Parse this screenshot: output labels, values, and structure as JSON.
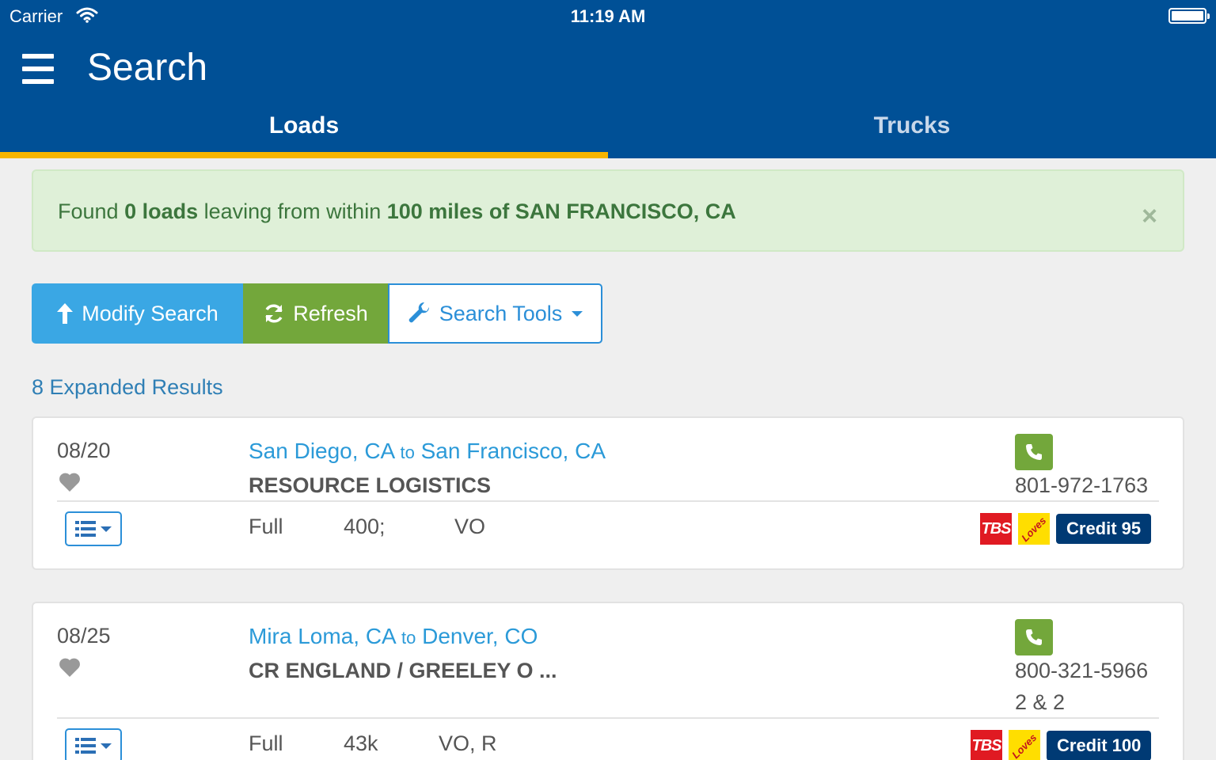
{
  "status_bar": {
    "carrier": "Carrier",
    "time": "11:19 AM"
  },
  "header": {
    "title": "Search"
  },
  "tabs": [
    {
      "label": "Loads",
      "active": true
    },
    {
      "label": "Trucks",
      "active": false
    }
  ],
  "alert": {
    "pre": "Found ",
    "count": "0 loads",
    "mid": " leaving from within ",
    "location": "100 miles of SAN FRANCISCO, CA",
    "close": "×"
  },
  "toolbar": {
    "modify_label": "Modify Search",
    "refresh_label": "Refresh",
    "tools_label": "Search Tools"
  },
  "results": {
    "count_label": "8 Expanded Results"
  },
  "loads": [
    {
      "date": "08/20",
      "origin": "San Diego, CA",
      "to": "to",
      "destination": "San Francisco, CA",
      "company": "RESOURCE LOGISTICS",
      "phone": "801-972-1763",
      "extra": "",
      "size": "Full",
      "weight": "400;",
      "equipment": "VO",
      "tbs": "TBS",
      "loves": "Loves",
      "credit": "Credit 95"
    },
    {
      "date": "08/25",
      "origin": "Mira Loma, CA",
      "to": "to",
      "destination": "Denver, CO",
      "company": "CR ENGLAND / GREELEY O ...",
      "phone": "800-321-5966",
      "extra": "2 & 2",
      "size": "Full",
      "weight": "43k",
      "equipment": "VO, R",
      "tbs": "TBS",
      "loves": "Loves",
      "credit": "Credit 100"
    }
  ],
  "colors": {
    "header": "#005096",
    "tab_indicator": "#f7b500",
    "alert_bg": "#dff0d8",
    "modify": "#3aa7e4",
    "refresh": "#73a73b",
    "link": "#2b9ad8",
    "credit": "#003a74"
  },
  "icons": [
    "wifi-icon",
    "battery-icon",
    "menu-icon",
    "arrow-up-icon",
    "refresh-icon",
    "wrench-icon",
    "heart-icon",
    "phone-icon",
    "list-icon"
  ]
}
